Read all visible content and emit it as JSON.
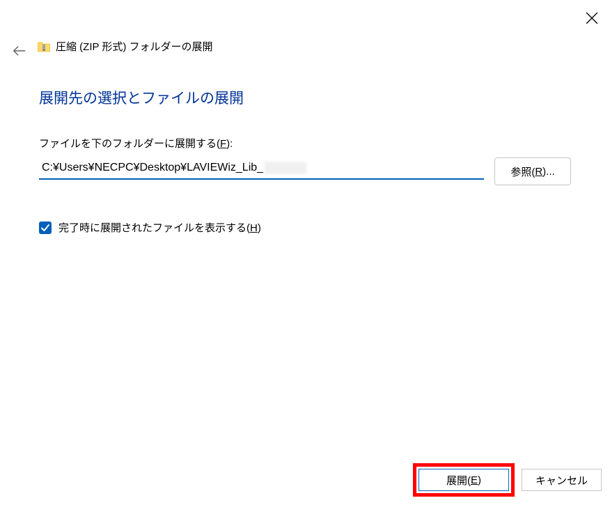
{
  "window": {
    "title": "圧縮 (ZIP 形式) フォルダーの展開"
  },
  "heading": "展開先の選択とファイルの展開",
  "destination": {
    "label_pre": "ファイルを下のフォルダーに展開する(",
    "label_key": "F",
    "label_post": "):",
    "path": "C:¥Users¥NECPC¥Desktop¥LAVIEWiz_Lib_"
  },
  "browse": {
    "pre": "参照(",
    "key": "R",
    "post": ")..."
  },
  "checkbox": {
    "checked": true,
    "pre": "完了時に展開されたファイルを表示する(",
    "key": "H",
    "post": ")"
  },
  "buttons": {
    "extract_pre": "展開(",
    "extract_key": "E",
    "extract_post": ")",
    "cancel": "キャンセル"
  }
}
